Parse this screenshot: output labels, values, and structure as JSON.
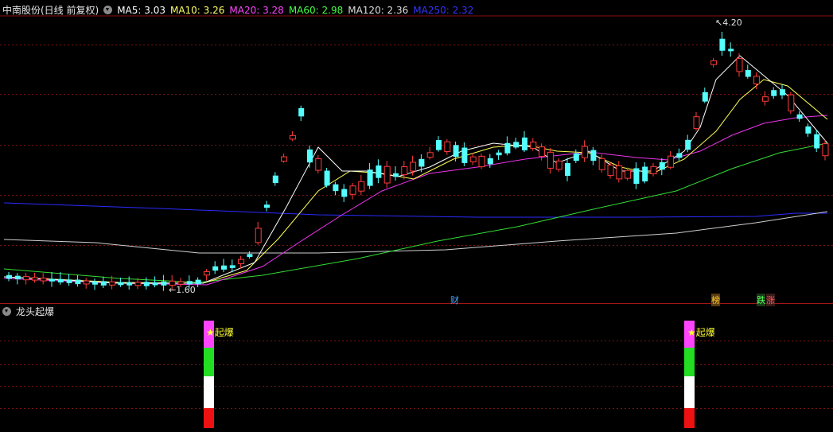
{
  "header": {
    "title": "中南股份(日线 前复权)",
    "ma_items": [
      {
        "label": "MA5: 3.03",
        "color": "#ffffff"
      },
      {
        "label": "MA10: 3.26",
        "color": "#ffff66"
      },
      {
        "label": "MA20: 3.28",
        "color": "#ff44ff"
      },
      {
        "label": "MA60: 2.98",
        "color": "#44ff44"
      },
      {
        "label": "MA120: 2.36",
        "color": "#dddddd"
      },
      {
        "label": "MA250: 2.32",
        "color": "#3333ff"
      }
    ]
  },
  "indicator": {
    "title": "龙头起爆",
    "signal_label": "★起爆"
  },
  "annotations": {
    "high_label": "4.20",
    "low_label": "1.60",
    "markers": [
      {
        "text": "财",
        "color": "#4da6ff"
      },
      {
        "text": "榜",
        "color": "#ffcc33"
      },
      {
        "text": "跌",
        "color": "#55ff55"
      },
      {
        "text": "涨",
        "color": "#ff5555"
      }
    ]
  },
  "chart_data": [
    {
      "type": "candlestick",
      "title": "中南股份(日线 前复权)",
      "price_high": 4.2,
      "price_low": 1.6,
      "up_color": "#ff3b3b",
      "down_color": "#54ffff",
      "series": [
        {
          "name": "MA5",
          "last": 3.03
        },
        {
          "name": "MA10",
          "last": 3.26
        },
        {
          "name": "MA20",
          "last": 3.28
        },
        {
          "name": "MA60",
          "last": 2.98
        },
        {
          "name": "MA120",
          "last": 2.36
        },
        {
          "name": "MA250",
          "last": 2.32
        }
      ]
    },
    {
      "type": "bar",
      "title": "龙头起爆",
      "signals": [
        {
          "label": "★起爆",
          "segments": [
            "#ff44ff",
            "#22dd22",
            "#ffffff",
            "#ee1111"
          ]
        },
        {
          "label": "★起爆",
          "segments": [
            "#ff44ff",
            "#22dd22",
            "#ffffff",
            "#ee1111"
          ]
        }
      ]
    }
  ]
}
